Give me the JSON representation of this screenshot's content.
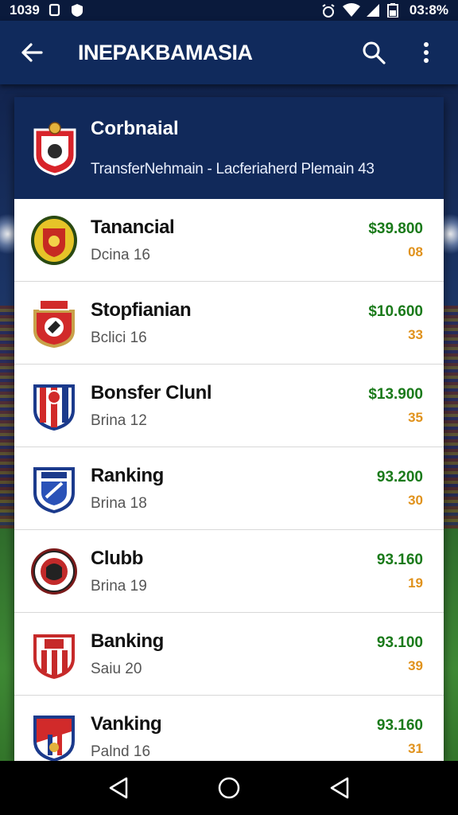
{
  "status_bar": {
    "time": "1039",
    "right_text": "03:8%"
  },
  "app_bar": {
    "title": "INEPAKBAMASIA"
  },
  "header": {
    "title": "Corbnaial",
    "subtitle": "TransferNehmain - Lacferiaherd Plemain 43"
  },
  "rows": [
    {
      "name": "Tanancial",
      "sub": "Dcina 16",
      "price": "$39.800",
      "score": "08",
      "crest": "crest-yellow"
    },
    {
      "name": "Stopfianian",
      "sub": "Bclici 16",
      "price": "$10.600",
      "score": "33",
      "crest": "crest-red-circle"
    },
    {
      "name": "Bonsfer Clunl",
      "sub": "Brina 12",
      "price": "$13.900",
      "score": "35",
      "crest": "crest-redblue-shield"
    },
    {
      "name": "Ranking",
      "sub": "Brina 18",
      "price": "93.200",
      "score": "30",
      "crest": "crest-blue-shield"
    },
    {
      "name": "Clubb",
      "sub": "Brina 19",
      "price": "93.160",
      "score": "19",
      "crest": "crest-round-dark"
    },
    {
      "name": "Banking",
      "sub": "Saiu 20",
      "price": "93.100",
      "score": "39",
      "crest": "crest-red-stripes"
    },
    {
      "name": "Vanking",
      "sub": "Palnd 16",
      "price": "93.160",
      "score": "31",
      "crest": "crest-blue-red-shield"
    }
  ],
  "colors": {
    "app_bar": "#102a5c",
    "header": "#11295a",
    "price": "#1a7a1a",
    "score": "#e0921c"
  }
}
